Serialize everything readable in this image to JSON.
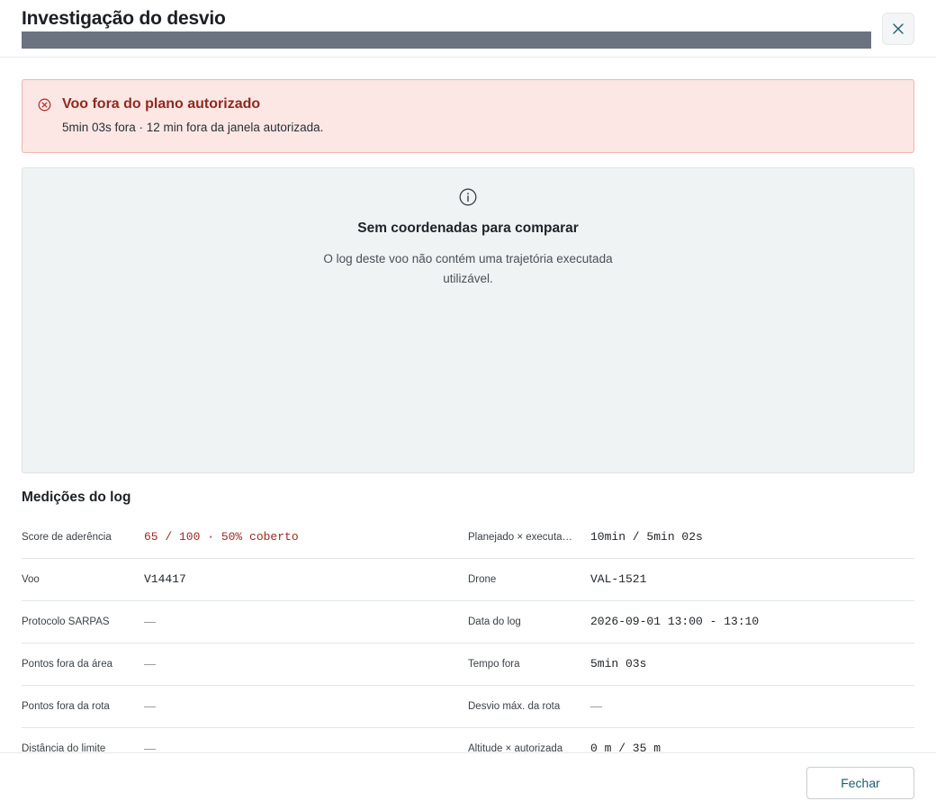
{
  "header": {
    "title": "Investigação do desvio"
  },
  "alert": {
    "title": "Voo fora do plano autorizado",
    "text": "5min 03s fora · 12 min fora da janela autorizada."
  },
  "empty_state": {
    "title": "Sem coordenadas para comparar",
    "text": "O log deste voo não contém uma trajetória executada utilizável."
  },
  "measurements": {
    "title": "Medições do log",
    "rows": [
      {
        "label_left": "Score de aderência",
        "value_left": "65 / 100 · 50% coberto",
        "label_right": "Planejado × executa…",
        "value_right": "10min / 5min 02s"
      },
      {
        "label_left": "Voo",
        "value_left": "V14417",
        "label_right": "Drone",
        "value_right": "VAL-1521"
      },
      {
        "label_left": "Protocolo SARPAS",
        "value_left": "—",
        "label_right": "Data do log",
        "value_right": "2026-09-01 13:00 - 13:10"
      },
      {
        "label_left": "Pontos fora da área",
        "value_left": "—",
        "label_right": "Tempo fora",
        "value_right": "5min 03s"
      },
      {
        "label_left": "Pontos fora da rota",
        "value_left": "—",
        "label_right": "Desvio máx. da rota",
        "value_right": "—"
      },
      {
        "label_left": "Distância do limite",
        "value_left": "—",
        "label_right": "Altitude × autorizada",
        "value_right": "0 m / 35 m"
      }
    ]
  },
  "footer": {
    "close_label": "Fechar"
  },
  "colors": {
    "danger": "#9a2a1e",
    "alert_bg": "#fde7e5",
    "accent": "#1e5f6b"
  },
  "icons": {
    "close": "close-icon",
    "alert": "error-circle-icon",
    "info": "info-icon"
  }
}
